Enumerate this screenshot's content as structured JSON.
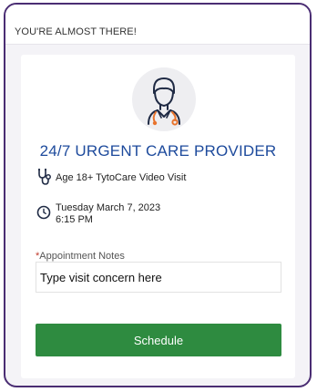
{
  "header": {
    "title": "YOU'RE ALMOST THERE!"
  },
  "provider": {
    "title": "24/7 URGENT CARE PROVIDER",
    "avatar_icon": "doctor-icon",
    "visit_icon": "stethoscope-icon",
    "visit_type": "Age 18+ TytoCare Video Visit",
    "time_icon": "clock-icon",
    "date": "Tuesday March 7, 2023",
    "time": "6:15 PM"
  },
  "notes": {
    "required_mark": "*",
    "label": "Appointment Notes",
    "placeholder": "Type visit concern here",
    "value": ""
  },
  "actions": {
    "schedule_label": "Schedule"
  },
  "colors": {
    "frame_border": "#4a2d73",
    "title": "#1d4a9c",
    "schedule_button": "#2e8b40",
    "required": "#c0392b",
    "icon_dark": "#1f2a44",
    "icon_orange": "#e8732c"
  }
}
